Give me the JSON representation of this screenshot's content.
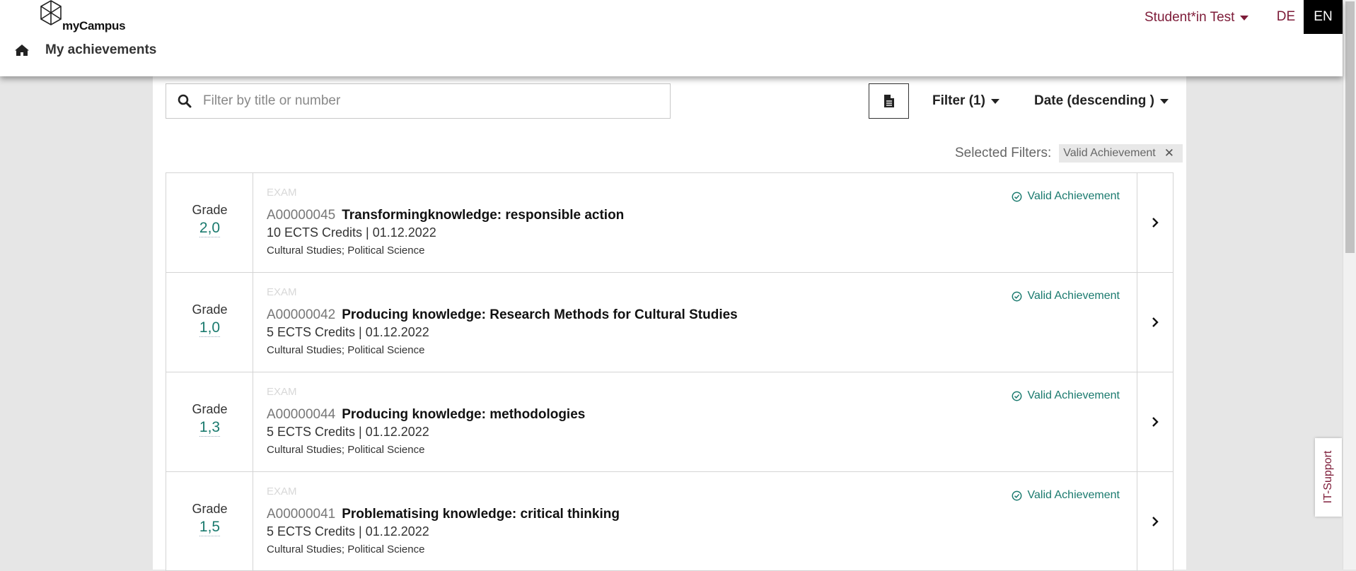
{
  "header": {
    "logo_text": "myCampus",
    "user_menu_label": "Student*in Test",
    "languages": [
      "DE",
      "EN"
    ],
    "active_language": "EN",
    "breadcrumb_title": "My achievements"
  },
  "toolbar": {
    "search_placeholder": "Filter by title or number",
    "search_value": "",
    "filter_label": "Filter (1)",
    "sort_label": "Date (descending )"
  },
  "selected_filters": {
    "label": "Selected Filters:",
    "chips": [
      "Valid Achievement"
    ]
  },
  "achievements": [
    {
      "grade_label": "Grade",
      "grade": "2,0",
      "kind": "EXAM",
      "number": "A00000045",
      "title": "Transformingknowledge: responsible action",
      "credits_date": "10 ECTS Credits | 01.12.2022",
      "subjects": "Cultural Studies; Political Science",
      "status": "Valid Achievement"
    },
    {
      "grade_label": "Grade",
      "grade": "1,0",
      "kind": "EXAM",
      "number": "A00000042",
      "title": "Producing knowledge: Research Methods for Cultural Studies",
      "credits_date": "5 ECTS Credits | 01.12.2022",
      "subjects": "Cultural Studies; Political Science",
      "status": "Valid Achievement"
    },
    {
      "grade_label": "Grade",
      "grade": "1,3",
      "kind": "EXAM",
      "number": "A00000044",
      "title": "Producing knowledge: methodologies",
      "credits_date": "5 ECTS Credits | 01.12.2022",
      "subjects": "Cultural Studies; Political Science",
      "status": "Valid Achievement"
    },
    {
      "grade_label": "Grade",
      "grade": "1,5",
      "kind": "EXAM",
      "number": "A00000041",
      "title": "Problematising knowledge: critical thinking",
      "credits_date": "5 ECTS Credits | 01.12.2022",
      "subjects": "Cultural Studies; Political Science",
      "status": "Valid Achievement"
    }
  ],
  "support_tab": "IT-Support",
  "colors": {
    "brand": "#7d1b38",
    "valid": "#1a7a6e",
    "background": "#e6e6e6"
  }
}
